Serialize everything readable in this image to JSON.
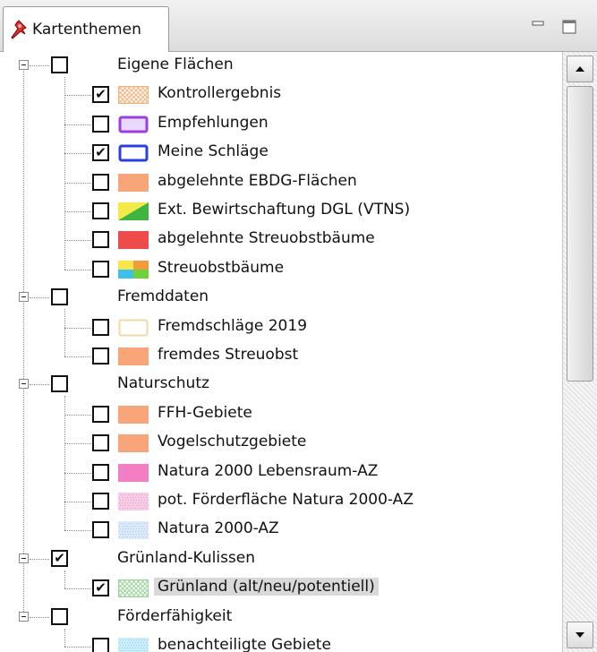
{
  "panel": {
    "tab_title": "Kartenthemen",
    "tab_icon": "pushpin-icon"
  },
  "tree": {
    "groups": [
      {
        "label": "Eigene Flächen",
        "checked": false,
        "expanded": true,
        "children": [
          {
            "label": "Kontrollergebnis",
            "checked": true,
            "swatch": "crosshatch-orange"
          },
          {
            "label": "Empfehlungen",
            "checked": false,
            "swatch": "outline-purple"
          },
          {
            "label": "Meine Schläge",
            "checked": true,
            "swatch": "outline-blue"
          },
          {
            "label": "abgelehnte EBDG-Flächen",
            "checked": false,
            "swatch": "fill-salmon"
          },
          {
            "label": "Ext. Bewirtschaftung DGL (VTNS)",
            "checked": false,
            "swatch": "diagonal-yellow-green"
          },
          {
            "label": "abgelehnte Streuobstbäume",
            "checked": false,
            "swatch": "fill-red"
          },
          {
            "label": "Streuobstbäume",
            "checked": false,
            "swatch": "quad-multicolor"
          }
        ]
      },
      {
        "label": "Fremddaten",
        "checked": false,
        "expanded": true,
        "children": [
          {
            "label": "Fremdschläge 2019",
            "checked": false,
            "swatch": "outline-cream"
          },
          {
            "label": "fremdes Streuobst",
            "checked": false,
            "swatch": "fill-salmon"
          }
        ]
      },
      {
        "label": "Naturschutz",
        "checked": false,
        "expanded": true,
        "children": [
          {
            "label": "FFH-Gebiete",
            "checked": false,
            "swatch": "fill-salmon"
          },
          {
            "label": "Vogelschutzgebiete",
            "checked": false,
            "swatch": "fill-salmon"
          },
          {
            "label": "Natura 2000 Lebensraum-AZ",
            "checked": false,
            "swatch": "fill-pink"
          },
          {
            "label": "pot. Förderfläche Natura 2000-AZ",
            "checked": false,
            "swatch": "dots-pink"
          },
          {
            "label": "Natura 2000-AZ",
            "checked": false,
            "swatch": "dots-lightblue"
          }
        ]
      },
      {
        "label": "Grünland-Kulissen",
        "checked": true,
        "expanded": true,
        "children": [
          {
            "label": "Grünland (alt/neu/potentiell)",
            "checked": true,
            "swatch": "crosshatch-green",
            "selected": true
          }
        ]
      },
      {
        "label": "Förderfähigkeit",
        "checked": false,
        "expanded": true,
        "children": [
          {
            "label": "benachteiligte Gebiete",
            "checked": false,
            "swatch": "dots-cyan"
          }
        ]
      }
    ]
  },
  "colors": {
    "salmon": "#f9a57a",
    "red": "#ee4b4b",
    "pink": "#f27fc4",
    "purple": "#9b3fe0",
    "blue": "#2a3fe0",
    "selection": "#d9d9d9"
  },
  "check_mark": "✔"
}
